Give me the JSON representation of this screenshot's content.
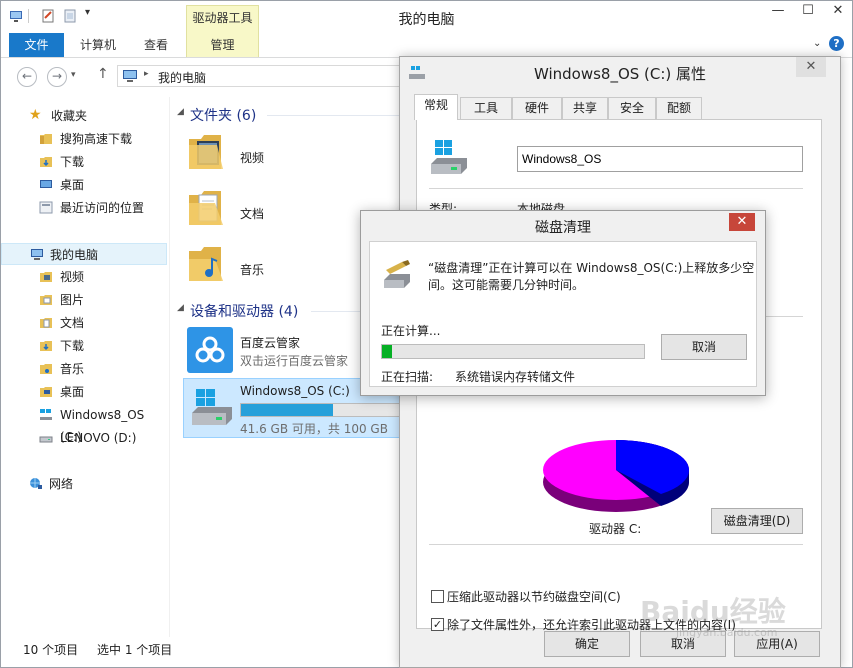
{
  "explorer": {
    "title": "我的电脑",
    "context_tab_group": "驱动器工具",
    "ribbon_tabs": [
      "文件",
      "计算机",
      "查看",
      "管理"
    ],
    "address": {
      "path": "我的电脑"
    },
    "nav": {
      "favorites": "收藏夹",
      "fav_items": [
        "搜狗高速下载",
        "下载",
        "桌面",
        "最近访问的位置"
      ],
      "computer": "我的电脑",
      "computer_items": [
        "视频",
        "图片",
        "文档",
        "下载",
        "音乐",
        "桌面",
        "Windows8_OS (C:)",
        "LENOVO (D:)"
      ],
      "network": "网络"
    },
    "folders_header": "文件夹 (6)",
    "folders": [
      "视频",
      "文档",
      "音乐"
    ],
    "devices_header": "设备和驱动器 (4)",
    "baidu": {
      "name": "百度云管家",
      "sub": "双击运行百度云管家"
    },
    "drive": {
      "name": "Windows8_OS (C:)",
      "space": "41.6 GB 可用，共 100 GB",
      "used_fraction": 0.584
    },
    "status": {
      "count": "10 个项目",
      "selected": "选中 1 个项目"
    }
  },
  "props": {
    "title": "Windows8_OS (C:) 属性",
    "tabs": [
      "常规",
      "工具",
      "硬件",
      "共享",
      "安全",
      "配额"
    ],
    "drive_name": "Windows8_OS",
    "type_label": "类型:",
    "type_value": "本地磁盘",
    "drive_label": "驱动器 C:",
    "cleanup_button": "磁盘清理(D)",
    "compress": "压缩此驱动器以节约磁盘空间(C)",
    "compress_checked": false,
    "index": "除了文件属性外，还允许索引此驱动器上文件的内容(I)",
    "index_checked": true,
    "ok": "确定",
    "cancel": "取消",
    "apply": "应用(A)"
  },
  "cleanup": {
    "title": "磁盘清理",
    "message_line1": "“磁盘清理”正在计算可以在 Windows8_OS(C:)上释放多少空",
    "message_line2": "间。这可能需要几分钟时间。",
    "calculating": "正在计算...",
    "progress_fraction": 0.04,
    "cancel": "取消",
    "scanning_label": "正在扫描:",
    "scanning_item": "系统错误内存转储文件"
  },
  "watermark": {
    "text": "Baidu经验",
    "url": "jingyan.baidu.com"
  },
  "colors": {
    "accent": "#1979ca",
    "drive_bar": "#26a0da",
    "progress_green": "#06b025",
    "pie_used": "#ff00ff",
    "pie_free": "#0000ff",
    "close_red": "#c7463a"
  }
}
